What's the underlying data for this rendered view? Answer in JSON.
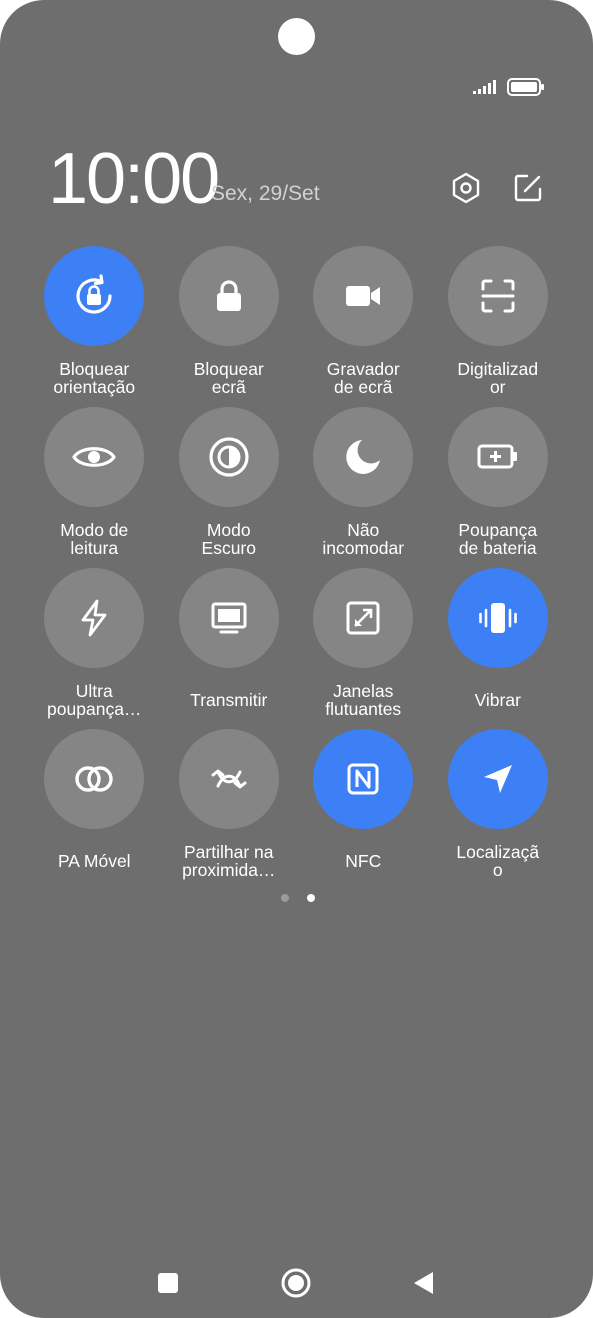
{
  "status_bar": {
    "signal_icon": "signal-bars-icon",
    "battery_icon": "battery-icon"
  },
  "header": {
    "time": "10:00",
    "date": "Sex, 29/Set",
    "settings_icon": "settings-hexagon-icon",
    "edit_icon": "edit-icon"
  },
  "tiles": [
    {
      "label": "Bloquear\norientação",
      "icon": "rotation-lock-icon",
      "active": true
    },
    {
      "label": "Bloquear\necrã",
      "icon": "lock-icon",
      "active": false
    },
    {
      "label": "Gravador\nde ecrã",
      "icon": "video-camera-icon",
      "active": false
    },
    {
      "label": "Digitalizad\nor",
      "icon": "scanner-icon",
      "active": false
    },
    {
      "label": "Modo de\nleitura",
      "icon": "eye-icon",
      "active": false
    },
    {
      "label": "Modo\nEscuro",
      "icon": "dark-mode-icon",
      "active": false
    },
    {
      "label": "Não\nincomodar",
      "icon": "moon-icon",
      "active": false
    },
    {
      "label": "Poupança\nde bateria",
      "icon": "battery-saver-icon",
      "active": false
    },
    {
      "label": "Ultra\npoupança…",
      "icon": "lightning-icon",
      "active": false
    },
    {
      "label": "Transmitir",
      "icon": "monitor-icon",
      "active": false
    },
    {
      "label": "Janelas\nflutuantes",
      "icon": "floating-window-icon",
      "active": false
    },
    {
      "label": "Vibrar",
      "icon": "vibrate-icon",
      "active": true
    },
    {
      "label": "PA Móvel",
      "icon": "hotspot-icon",
      "active": false
    },
    {
      "label": "Partilhar na\nproximida…",
      "icon": "nearby-share-icon",
      "active": false
    },
    {
      "label": "NFC",
      "icon": "nfc-icon",
      "active": true
    },
    {
      "label": "Localizaçã\no",
      "icon": "location-arrow-icon",
      "active": true
    }
  ],
  "pager": {
    "pages": 2,
    "current": 2
  },
  "nav": {
    "recents_icon": "recents-square-icon",
    "home_icon": "home-circle-icon",
    "back_icon": "back-triangle-icon"
  },
  "colors": {
    "background": "#6e6e6e",
    "tile_inactive": "#858585",
    "tile_active": "#3d7ff5",
    "text": "#ffffff"
  }
}
